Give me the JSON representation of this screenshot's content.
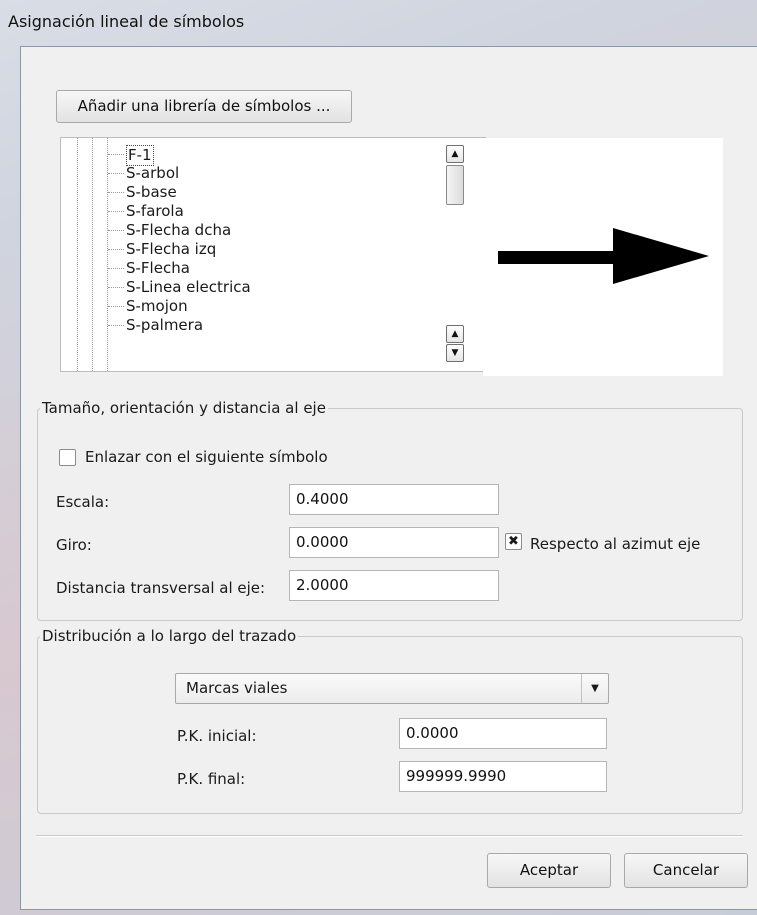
{
  "window": {
    "title": "Asignación lineal de símbolos"
  },
  "library_button": "Añadir una librería de símbolos ...",
  "symbol_list": {
    "items": [
      "F-1",
      "S-arbol",
      "S-base",
      "S-farola",
      "S-Flecha dcha",
      "S-Flecha izq",
      "S-Flecha",
      "S-Linea electrica",
      "S-mojon",
      "S-palmera"
    ],
    "selected": "F-1"
  },
  "preview": {
    "symbol_icon": "right-arrow-icon"
  },
  "size_group": {
    "legend": "Tamaño, orientación y distancia al eje",
    "link_checkbox_label": "Enlazar con el siguiente símbolo",
    "link_checked": false,
    "scale_label": "Escala:",
    "scale_value": "0.4000",
    "rotation_label": "Giro:",
    "rotation_value": "0.0000",
    "azimuth_label": "Respecto al azimut eje",
    "azimuth_checked": true,
    "distance_label": "Distancia transversal al eje:",
    "distance_value": "2.0000"
  },
  "dist_group": {
    "legend": "Distribución a lo largo del trazado",
    "mode_selected": "Marcas viales",
    "pk_start_label": "P.K. inicial:",
    "pk_start_value": "0.0000",
    "pk_end_label": "P.K. final:",
    "pk_end_value": "999999.9990"
  },
  "footer": {
    "ok": "Aceptar",
    "cancel": "Cancelar"
  }
}
